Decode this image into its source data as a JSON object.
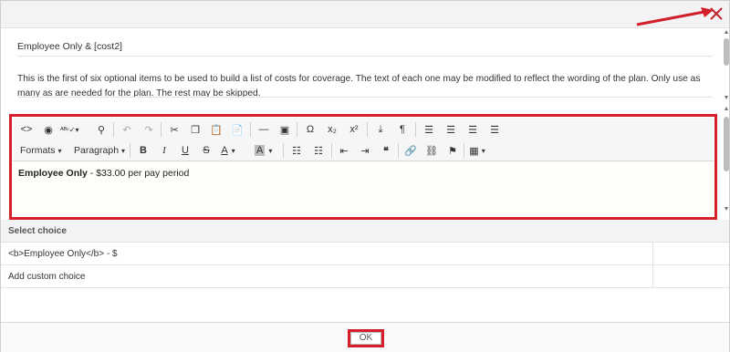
{
  "dialog": {
    "close_icon": "close-icon",
    "heading": "Employee Only & [cost2]",
    "description": "This is the first of six optional items to be used to build a list of costs for coverage. The text of each one may be modified to reflect the wording of the plan. Only use as many as are needed for the plan. The rest may be skipped.",
    "ok_label": "OK",
    "accent_color": "#d21f2a"
  },
  "toolbar": {
    "formats_label": "Formats",
    "paragraph_label": "Paragraph",
    "row1_icons": [
      "source-code-icon",
      "preview-icon",
      "spellcheck-icon",
      "find-icon",
      "undo-icon",
      "redo-icon",
      "cut-icon",
      "copy-icon",
      "paste-icon",
      "paste-text-icon",
      "horizontal-rule-icon",
      "image-icon",
      "special-char-icon",
      "subscript-icon",
      "superscript-icon",
      "insert-icon",
      "paragraph-mark-icon",
      "align-left-icon",
      "align-center-icon",
      "align-right-icon",
      "justify-icon"
    ],
    "row2_icons": [
      "bold-icon",
      "italic-icon",
      "underline-icon",
      "strikethrough-icon",
      "text-color-icon",
      "background-color-icon",
      "bullet-list-icon",
      "numbered-list-icon",
      "outdent-icon",
      "indent-icon",
      "blockquote-icon",
      "link-icon",
      "unlink-icon",
      "bookmark-icon",
      "table-icon"
    ]
  },
  "editor": {
    "bold_text": "Employee Only",
    "rest_text": " - $33.00 per pay period"
  },
  "choices": {
    "header": "Select choice",
    "items": [
      "<b>Employee Only</b> - $",
      "Add custom choice"
    ]
  }
}
